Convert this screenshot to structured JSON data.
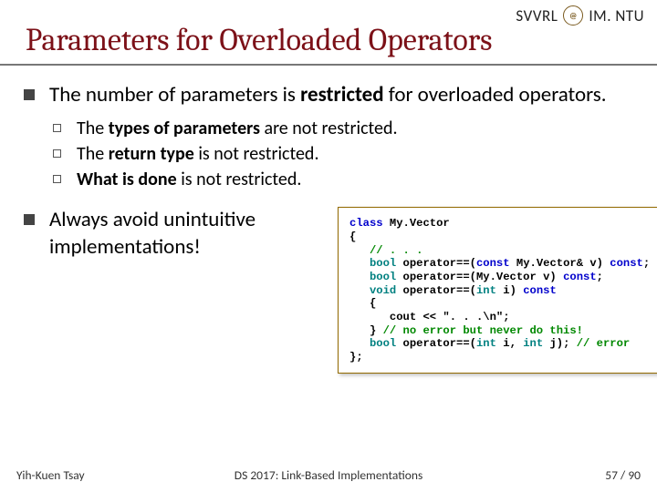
{
  "header": {
    "left": "SVVRL",
    "right": "IM. NTU"
  },
  "title": "Parameters for Overloaded Operators",
  "bullets": {
    "0": {
      "pre": "The number of parameters is ",
      "b": "restricted ",
      "post": "for overloaded operators."
    },
    "0a": {
      "pre": "The ",
      "b": "types of parameters ",
      "post": "are not restricted."
    },
    "0b": {
      "pre": "The ",
      "b": "return type ",
      "post": "is not restricted."
    },
    "0c": {
      "b": "What is done ",
      "post": "is not restricted."
    },
    "1": "Always avoid unintuitive implementations!"
  },
  "code": {
    "l0": {
      "a": "class",
      "b": " My.Vector"
    },
    "l1": "{",
    "l2": {
      "a": "   ",
      "b": "// . . ."
    },
    "l3": {
      "a": "   ",
      "b": "bool",
      "c": " operator==(",
      "d": "const",
      "e": " My.Vector& v) ",
      "f": "const",
      "g": ";"
    },
    "l4": {
      "a": "   ",
      "b": "bool",
      "c": " operator==(My.Vector v) ",
      "d": "const",
      "e": ";"
    },
    "l5": {
      "a": "   ",
      "b": "void",
      "c": " operator==(",
      "d": "int",
      "e": " i) ",
      "f": "const"
    },
    "l6": "   {",
    "l7": {
      "a": "      cout << ",
      "b": "\". . .\\n\"",
      "c": ";"
    },
    "l8": {
      "a": "   } ",
      "b": "// no error but never do this!"
    },
    "l9": {
      "a": "   ",
      "b": "bool",
      "c": " operator==(",
      "d": "int",
      "e": " i, ",
      "f": "int",
      "g": " j); ",
      "h": "// error"
    },
    "l10": "};"
  },
  "footer": {
    "left": "Yih-Kuen Tsay",
    "mid": "DS 2017: Link-Based Implementations",
    "right_a": "57 ",
    "right_b": "/ 90"
  }
}
